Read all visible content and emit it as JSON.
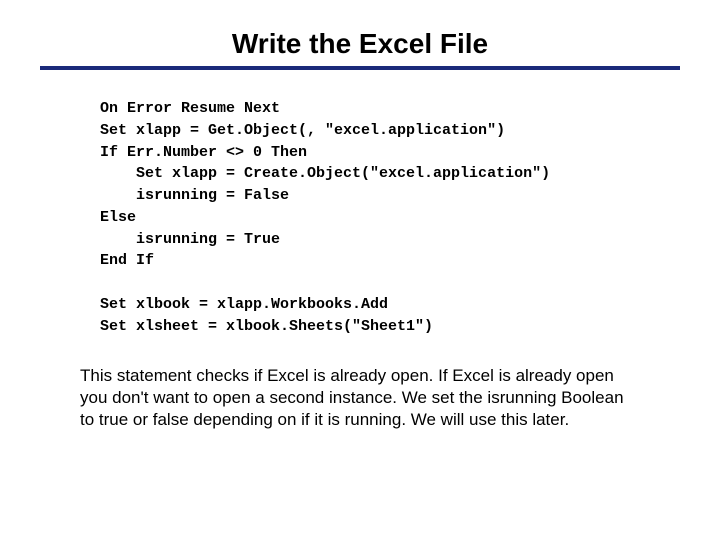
{
  "title": "Write the Excel File",
  "code": "On Error Resume Next\nSet xlapp = Get.Object(, \"excel.application\")\nIf Err.Number <> 0 Then\n    Set xlapp = Create.Object(\"excel.application\")\n    isrunning = False\nElse\n    isrunning = True\nEnd If\n\nSet xlbook = xlapp.Workbooks.Add\nSet xlsheet = xlbook.Sheets(\"Sheet1\")",
  "description": "This statement checks if Excel is already open.  If Excel is already open you don't want to open a second instance.  We set the isrunning Boolean to true or false depending on if it is running. We will use this later."
}
